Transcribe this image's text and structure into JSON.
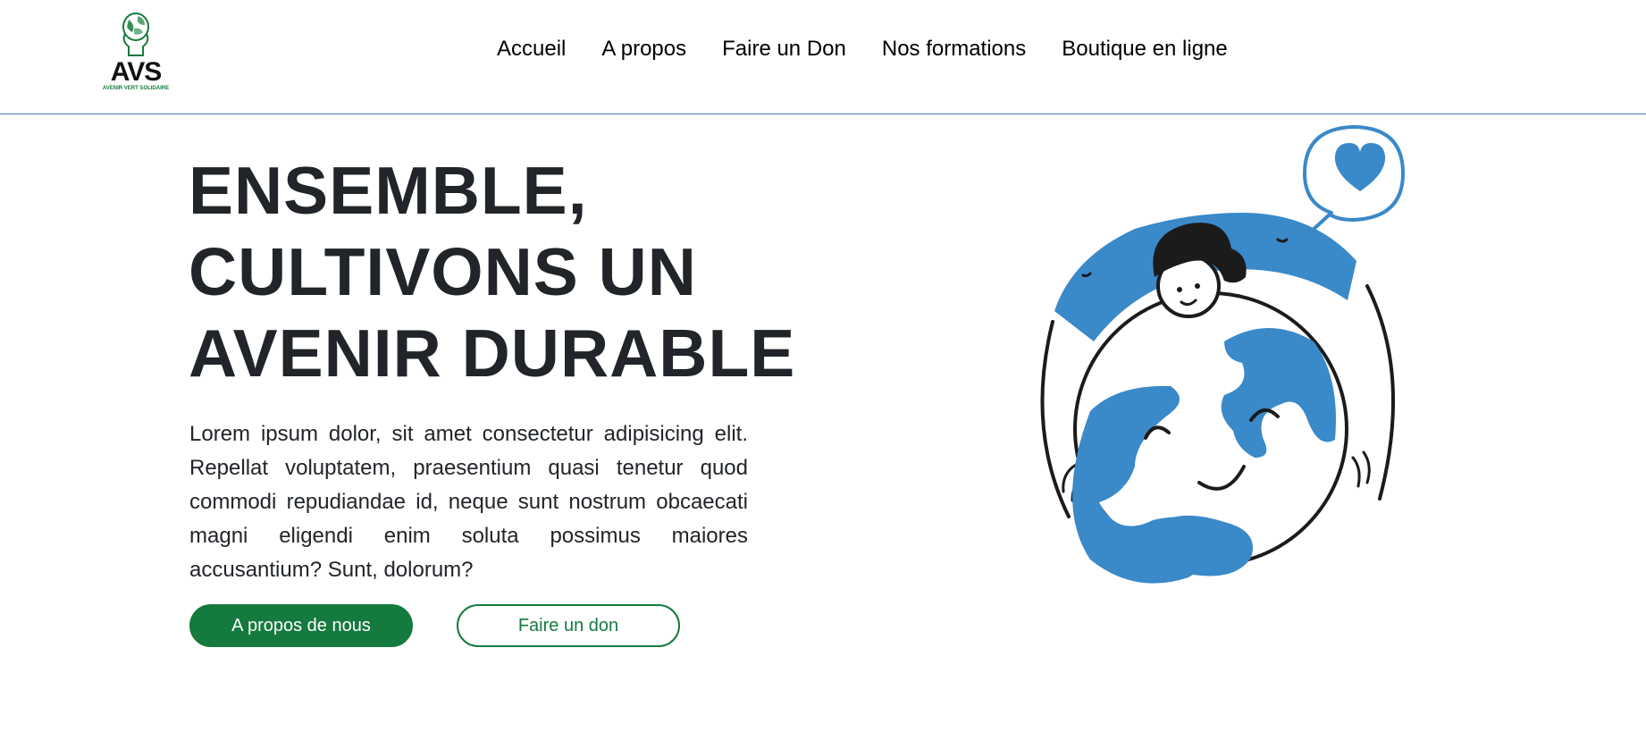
{
  "brand": {
    "logo_letters": "AVS",
    "logo_tagline": "AVENIR VERT SOLIDAIRE",
    "colors": {
      "green": "#157a3d",
      "blue": "#3a89c9",
      "dark": "#212529"
    }
  },
  "nav": {
    "items": [
      {
        "label": "Accueil"
      },
      {
        "label": "A propos"
      },
      {
        "label": "Faire un Don"
      },
      {
        "label": "Nos formations"
      },
      {
        "label": "Boutique en ligne"
      }
    ]
  },
  "hero": {
    "title_lines": [
      "ENSEMBLE,",
      "CULTIVONS UN",
      "AVENIR DURABLE"
    ],
    "text": "Lorem ipsum dolor, sit amet consectetur adipisicing elit. Repellat voluptatem, praesentium quasi tenetur quod commodi repudiandae id, neque sunt nostrum obcaecati magni eligendi enim soluta possimus maiores accusantium? Sunt, dolorum?",
    "primary_button": "A propos de nous",
    "secondary_button": "Faire un don"
  },
  "illustration": {
    "icons": [
      "person-hugging-earth-icon",
      "heart-speech-bubble-icon"
    ]
  }
}
